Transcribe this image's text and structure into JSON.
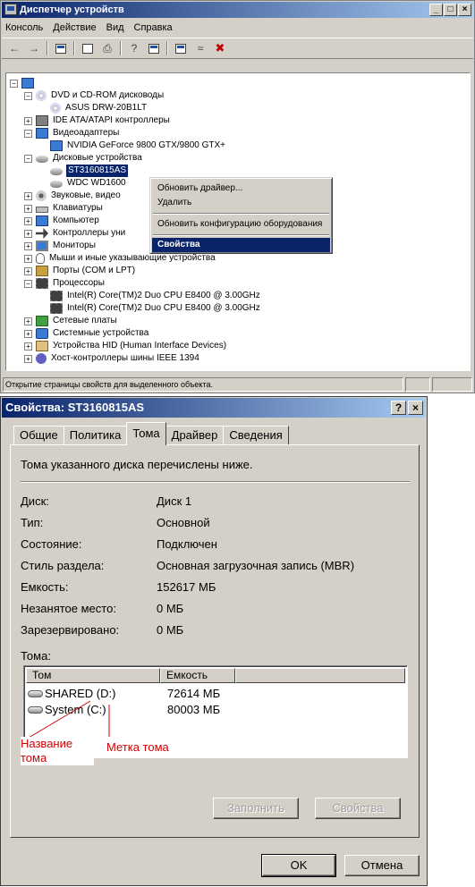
{
  "device_manager": {
    "title": "Диспетчер устройств",
    "caption_buttons": [
      "_",
      "□",
      "×"
    ],
    "menu": [
      "Консоль",
      "Действие",
      "Вид",
      "Справка"
    ],
    "toolbar": [
      "back-arrow-icon",
      "forward-arrow-icon",
      "console-tree-icon",
      "properties-icon",
      "print-icon",
      "help-icon",
      "view-icon",
      "scan-hardware-icon",
      "disable-device-icon",
      "uninstall-icon"
    ],
    "tree": [
      {
        "depth": 0,
        "expand": "−",
        "icon": "ic-root",
        "label": ""
      },
      {
        "depth": 1,
        "expand": "−",
        "icon": "ic-cd",
        "label": "DVD и CD-ROM дисководы"
      },
      {
        "depth": 2,
        "expand": "",
        "icon": "ic-cd",
        "label": "ASUS DRW-20B1LT"
      },
      {
        "depth": 1,
        "expand": "+",
        "icon": "ic-ctrl",
        "label": "IDE ATA/ATAPI контроллеры"
      },
      {
        "depth": 1,
        "expand": "−",
        "icon": "ic-video",
        "label": "Видеоадаптеры"
      },
      {
        "depth": 2,
        "expand": "",
        "icon": "ic-video",
        "label": "NVIDIA GeForce 9800 GTX/9800 GTX+"
      },
      {
        "depth": 1,
        "expand": "−",
        "icon": "ic-disk",
        "label": "Дисковые устройства"
      },
      {
        "depth": 2,
        "expand": "",
        "icon": "ic-disk",
        "label": "ST3160815AS",
        "selected": true
      },
      {
        "depth": 2,
        "expand": "",
        "icon": "ic-disk",
        "label": "WDC WD1600"
      },
      {
        "depth": 1,
        "expand": "+",
        "icon": "ic-sound",
        "label": "Звуковые, видео"
      },
      {
        "depth": 1,
        "expand": "+",
        "icon": "ic-kbd",
        "label": "Клавиатуры"
      },
      {
        "depth": 1,
        "expand": "+",
        "icon": "ic-comp",
        "label": "Компьютер"
      },
      {
        "depth": 1,
        "expand": "+",
        "icon": "ic-usb",
        "label": "Контроллеры уни"
      },
      {
        "depth": 1,
        "expand": "+",
        "icon": "ic-mon",
        "label": "Мониторы"
      },
      {
        "depth": 1,
        "expand": "+",
        "icon": "ic-mouse",
        "label": "Мыши и иные указывающие устройства"
      },
      {
        "depth": 1,
        "expand": "+",
        "icon": "ic-port",
        "label": "Порты (COM и LPT)"
      },
      {
        "depth": 1,
        "expand": "−",
        "icon": "ic-cpu",
        "label": "Процессоры"
      },
      {
        "depth": 2,
        "expand": "",
        "icon": "ic-cpu",
        "label": "Intel(R) Core(TM)2 Duo CPU     E8400  @ 3.00GHz"
      },
      {
        "depth": 2,
        "expand": "",
        "icon": "ic-cpu",
        "label": "Intel(R) Core(TM)2 Duo CPU     E8400  @ 3.00GHz"
      },
      {
        "depth": 1,
        "expand": "+",
        "icon": "ic-net",
        "label": "Сетевые платы"
      },
      {
        "depth": 1,
        "expand": "+",
        "icon": "ic-sys",
        "label": "Системные устройства"
      },
      {
        "depth": 1,
        "expand": "+",
        "icon": "ic-hid",
        "label": "Устройства HID (Human Interface Devices)"
      },
      {
        "depth": 1,
        "expand": "+",
        "icon": "ic-1394",
        "label": "Хост-контроллеры шины IEEE 1394"
      }
    ],
    "context_menu": [
      "Обновить драйвер...",
      "Удалить",
      "Обновить конфигурацию оборудования",
      "Свойства"
    ],
    "status": "Открытие страницы свойств для выделенного объекта."
  },
  "properties": {
    "title": "Свойства: ST3160815AS",
    "caption_buttons": [
      "?",
      "×"
    ],
    "tabs": [
      "Общие",
      "Политика",
      "Тома",
      "Драйвер",
      "Сведения"
    ],
    "active_tab": "Тома",
    "description": "Тома указанного диска перечислены ниже.",
    "rows": [
      {
        "k": "Диск:",
        "v": "Диск 1"
      },
      {
        "k": "Тип:",
        "v": "Основной"
      },
      {
        "k": "Состояние:",
        "v": "Подключен"
      },
      {
        "k": "Стиль раздела:",
        "v": "Основная загрузочная запись (MBR)"
      },
      {
        "k": "Емкость:",
        "v": "152617 МБ"
      },
      {
        "k": "Незанятое место:",
        "v": "0 МБ"
      },
      {
        "k": "Зарезервировано:",
        "v": "0 МБ"
      }
    ],
    "volumes_label": "Тома:",
    "volume_columns": [
      "Том",
      "Емкость"
    ],
    "volumes": [
      {
        "name": "SHARED (D:)",
        "capacity": "72614 МБ"
      },
      {
        "name": "System (C:)",
        "capacity": "80003 МБ"
      }
    ],
    "populate_button": "Заполнить",
    "properties_button": "Свойства",
    "ok_button": "OK",
    "cancel_button": "Отмена"
  },
  "annotations": {
    "volume_name": "Название\nтома",
    "volume_label": "Метка тома",
    "color": "#d00000"
  }
}
